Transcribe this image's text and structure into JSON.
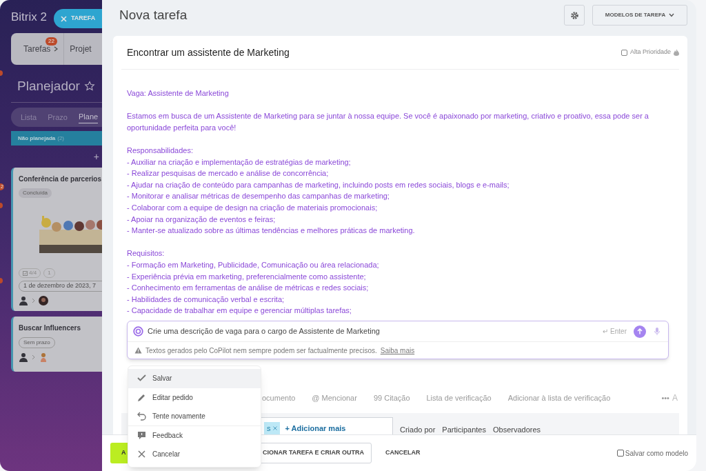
{
  "background_app": {
    "logo": "Bitrix 2",
    "close_task_button": "TAREFA",
    "nav_tabs": [
      {
        "label": "Tarefas",
        "badge": "22"
      },
      {
        "label": "Projet"
      }
    ],
    "edge_badges": [
      {
        "text": "2"
      }
    ],
    "page_title": "Planejador",
    "view_tabs": [
      {
        "label": "Lista",
        "selected": false
      },
      {
        "label": "Prazo",
        "selected": false
      },
      {
        "label": "Plane",
        "selected": true
      }
    ],
    "column": {
      "title": "Não planejada",
      "count": "(2)",
      "add": "+"
    },
    "cards": [
      {
        "title": "Conferência de parcerios",
        "status": "Concluída",
        "checklist": "4/4",
        "files": "1",
        "date": "1 de dezembro de 2023, 7"
      },
      {
        "kind": "plain",
        "title": "Buscar Influencers",
        "status": "Sem prazo"
      }
    ]
  },
  "header": {
    "title": "Nova tarefa",
    "templates_button": "MODELOS DE TAREFA"
  },
  "task": {
    "title": "Encontrar um assistente de Marketing",
    "high_priority": {
      "label": "Alta Prioridade",
      "checked": false
    },
    "description": [
      [
        "Vaga: Assistente de Marketing"
      ],
      [
        "Estamos em busca de um Assistente de Marketing para se juntar à nossa equipe. Se você é apaixonado por marketing, criativo e proativo, essa pode ser a",
        "oportunidade perfeita para você!"
      ],
      [
        "Responsabilidades:",
        "- Auxiliar na criação e implementação de estratégias de marketing;",
        "- Realizar pesquisas de mercado e análise de concorrência;",
        "- Ajudar na criação de conteúdo para campanhas de marketing, incluindo posts em redes sociais, blogs e e-mails;",
        "- Monitorar e analisar métricas de desempenho das campanhas de marketing;",
        "- Colaborar com a equipe de design na criação de materiais promocionais;",
        "- Apoiar na organização de eventos e feiras;",
        "- Manter-se atualizado sobre as últimas tendências e melhores práticas de marketing."
      ],
      [
        "Requisitos:",
        "- Formação em Marketing, Publicidade, Comunicação ou área relacionada;",
        "- Experiência prévia em marketing, preferencialmente como assistente;",
        "- Conhecimento em ferramentas de análise de métricas e redes sociais;",
        "- Habilidades de comunicação verbal e escrita;",
        "- Capacidade de trabalhar em equipe e gerenciar múltiplas tarefas;"
      ]
    ],
    "toolbar": [
      "ocumento",
      "@ Mencionar",
      "99 Citação",
      "Lista de verificação",
      "Adicionar à lista de verificação"
    ],
    "toolbar_more": "•••",
    "toolbar_format": "A",
    "tag": "s",
    "add_more": "+ Adicionar mais",
    "role_tabs": [
      "Criado por",
      "Participantes",
      "Observadores"
    ]
  },
  "copilot": {
    "prompt": "Crie uma descrição de vaga para o cargo de Assistente de Marketing",
    "enter_hint": "↵ Enter",
    "notice": "Textos gerados pelo CoPilot nem sempre podem ser factualmente precisos.",
    "learn_more": "Saiba mais"
  },
  "copilot_menu": [
    {
      "label": "Salvar",
      "selected": true
    },
    {
      "label": "Editar pedido",
      "selected": false
    },
    {
      "label": "Tente novamente",
      "selected": false
    },
    {
      "label": "Feedback",
      "selected": false
    },
    {
      "label": "Cancelar",
      "selected": false
    }
  ],
  "footer": {
    "add_button": "A",
    "add_and_new_button": "CIONAR TAREFA E CRIAR OUTRA",
    "cancel_button": "CANCELAR",
    "save_template": {
      "label": "Salvar como modelo",
      "checked": false
    }
  }
}
